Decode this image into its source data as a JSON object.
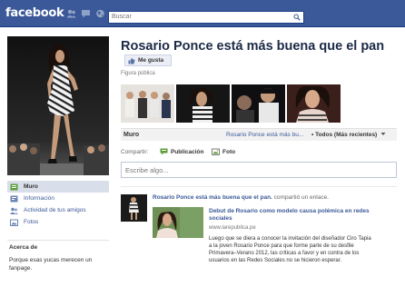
{
  "topbar": {
    "logo": "facebook",
    "search_placeholder": "Buscar"
  },
  "page": {
    "title": "Rosario Ponce está más buena que el pan",
    "like_label": "Me gusta",
    "category": "Figura pública"
  },
  "leftnav": {
    "items": [
      {
        "label": "Muro",
        "icon": "wall-icon"
      },
      {
        "label": "Información",
        "icon": "info-icon"
      },
      {
        "label": "Actividad de tus amigos",
        "icon": "friends-icon"
      },
      {
        "label": "Fotos",
        "icon": "photos-icon"
      }
    ]
  },
  "about": {
    "title": "Acerca de",
    "text": "Porque esas yucas merecen un fanpage."
  },
  "wall": {
    "tab_label": "Muro",
    "filter_page": "Rosario Ponce está más bu...",
    "filter_all": "• Todos (Más recientes)"
  },
  "share": {
    "label": "Compartir:",
    "publicacion": "Publicación",
    "foto": "Foto",
    "composer_placeholder": "Escribe algo..."
  },
  "story": {
    "author": "Rosario Ponce está más buena que el pan.",
    "action": " compartió un enlace.",
    "link_title": "Debut de Rosario como modelo causa polémica en redes sociales",
    "link_domain": "www.larepublica.pe",
    "link_desc": "Luego que se diera a conocer la invitación del diseñador Ciro Tapia a la joven Rosario Ponce para que forme parte de su desfile Primavera–Verano 2012, las críticas a favor y en contra de los usuarios en las Redes Sociales no se hicieron esperar."
  },
  "colors": {
    "brand": "#3b5998",
    "link": "#3b5998"
  }
}
